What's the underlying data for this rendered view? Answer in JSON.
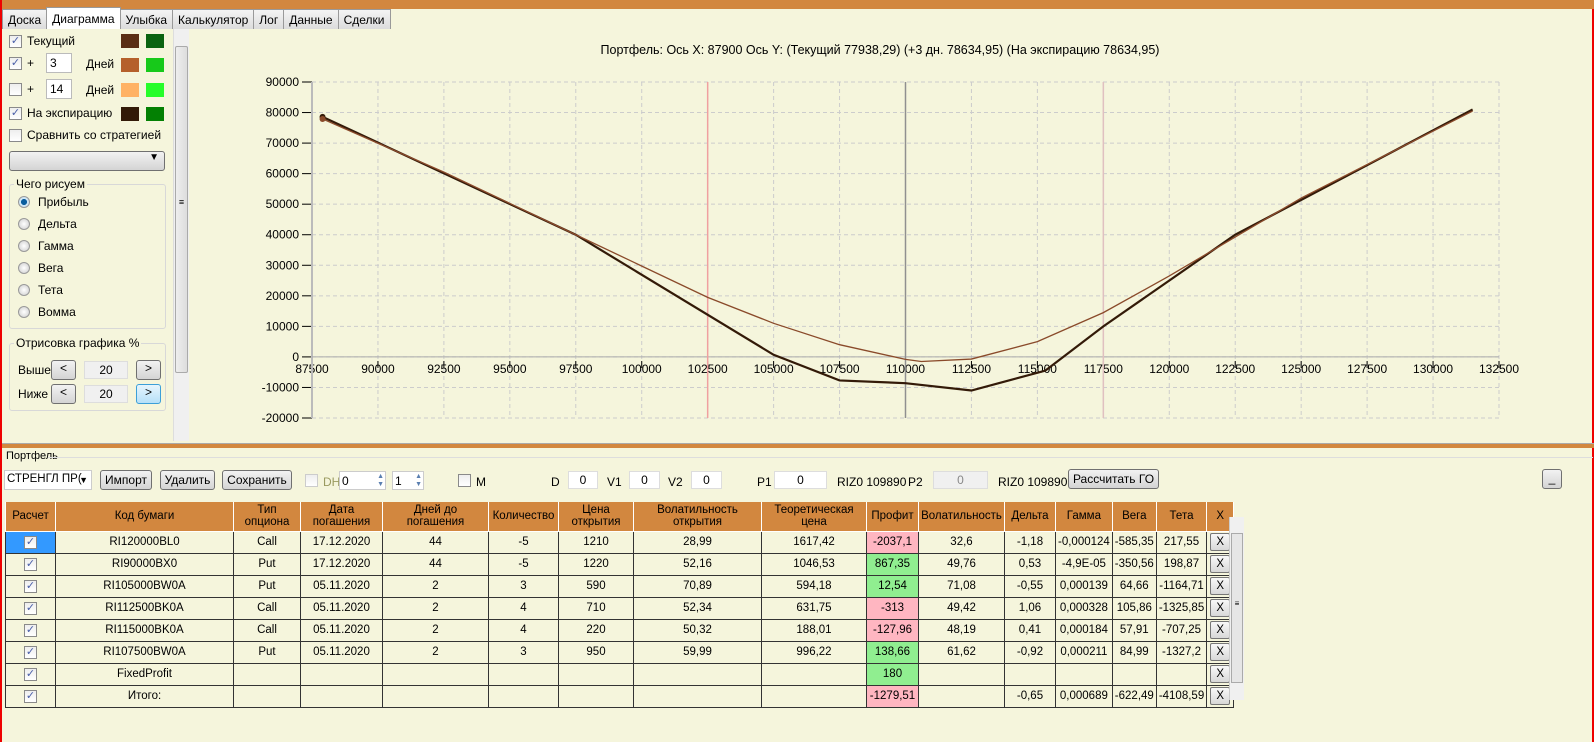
{
  "tabs": [
    "Доска",
    "Диаграмма",
    "Улыбка",
    "Калькулятор",
    "Лог",
    "Данные",
    "Сделки"
  ],
  "active_tab": "Диаграмма",
  "left": {
    "current_label": "Текущий",
    "plus": "+",
    "days_label": "Дней",
    "days1": "3",
    "days2": "14",
    "expiry_label": "На экспирацию",
    "compare_label": "Сравнить со стратегией",
    "colors": {
      "current": [
        "#5a2d14",
        "#0a6310"
      ],
      "d1": [
        "#b5602b",
        "#17c91a"
      ],
      "d2": [
        "#ffb265",
        "#27fd2a"
      ],
      "expiry": [
        "#331a08",
        "#038003"
      ]
    },
    "draw_group": "Чего рисуем",
    "radios": [
      "Прибыль",
      "Дельта",
      "Гамма",
      "Вега",
      "Тета",
      "Вомма"
    ],
    "pct_group": "Отрисовка графика %",
    "above": "Выше",
    "below": "Ниже",
    "above_val": "20",
    "below_val": "20",
    "lt": "<",
    "gt": ">"
  },
  "chart_title": "Портфель: Ось X: 87900 Ось Y:  (Текущий 77938,29)  (+3 дн. 78634,95)  (На экспирацию 78634,95)",
  "chart_data": {
    "type": "line",
    "xlim": [
      87500,
      132500
    ],
    "ylim": [
      -20000,
      90000
    ],
    "xticks": [
      87500,
      90000,
      92500,
      95000,
      97500,
      100000,
      102500,
      105000,
      107500,
      110000,
      112500,
      115000,
      117500,
      120000,
      122500,
      125000,
      127500,
      130000,
      132500
    ],
    "yticks": [
      -20000,
      -10000,
      0,
      10000,
      20000,
      30000,
      40000,
      50000,
      60000,
      70000,
      80000,
      90000
    ],
    "vlines": [
      {
        "x": 102500,
        "color": "#f0a0a0"
      },
      {
        "x": 110000,
        "color": "#909090"
      },
      {
        "x": 117500,
        "color": "#e0c0c0"
      }
    ],
    "series": [
      {
        "name": "На экспирацию",
        "color": "#331a08",
        "x": [
          87900,
          97500,
          105000,
          107500,
          110000,
          112500,
          115300,
          117500,
          122500,
          131500
        ],
        "y": [
          78600,
          40000,
          700,
          -7700,
          -8600,
          -11000,
          -4500,
          10000,
          40000,
          81000
        ]
      },
      {
        "name": "Текущий",
        "color": "#8a4a2a",
        "x": [
          87900,
          92500,
          97500,
          102500,
          105000,
          107500,
          110000,
          110600,
          112500,
          115000,
          117500,
          120000,
          125000,
          131500
        ],
        "y": [
          77900,
          60500,
          40000,
          19500,
          11000,
          4000,
          -800,
          -1500,
          -700,
          5000,
          14500,
          26500,
          52000,
          80500
        ]
      }
    ]
  },
  "portfolio": {
    "title": "Портфель",
    "strategy": "СТРЕНГЛ ПР(",
    "import": "Импорт",
    "delete": "Удалить",
    "save": "Сохранить",
    "dh": "DH",
    "spin1": "0",
    "spin2": "1",
    "m": "M",
    "d": "D",
    "d_val": "0",
    "v1": "V1",
    "v1_val": "0",
    "v2": "V2",
    "v2_val": "0",
    "p1": "P1",
    "p1_val": "0",
    "riz1": "RIZ0 109890",
    "p2": "P2",
    "p2_val": "0",
    "riz2": "RIZ0 109890",
    "calc": "Рассчитать ГО",
    "min": "_"
  },
  "table": {
    "headers": [
      "Расчет",
      "Код бумаги",
      "Тип опциона",
      "Дата погашения",
      "Дней до погашения",
      "Количество",
      "Цена открытия",
      "Волатильность открытия",
      "Теоретическая цена",
      "Профит",
      "Волатильность",
      "Дельта",
      "Гамма",
      "Вега",
      "Тета",
      "X"
    ],
    "rows": [
      [
        "RI120000BL0",
        "Call",
        "17.12.2020",
        "44",
        "-5",
        "1210",
        "28,99",
        "1617,42",
        "-2037,1",
        "32,6",
        "-1,18",
        "-0,000124",
        "-585,35",
        "217,55"
      ],
      [
        "RI90000BX0",
        "Put",
        "17.12.2020",
        "44",
        "-5",
        "1220",
        "52,16",
        "1046,53",
        "867,35",
        "49,76",
        "0,53",
        "-4,9E-05",
        "-350,56",
        "198,87"
      ],
      [
        "RI105000BW0A",
        "Put",
        "05.11.2020",
        "2",
        "3",
        "590",
        "70,89",
        "594,18",
        "12,54",
        "71,08",
        "-0,55",
        "0,000139",
        "64,66",
        "-1164,71"
      ],
      [
        "RI112500BK0A",
        "Call",
        "05.11.2020",
        "2",
        "4",
        "710",
        "52,34",
        "631,75",
        "-313",
        "49,42",
        "1,06",
        "0,000328",
        "105,86",
        "-1325,85"
      ],
      [
        "RI115000BK0A",
        "Call",
        "05.11.2020",
        "2",
        "4",
        "220",
        "50,32",
        "188,01",
        "-127,96",
        "48,19",
        "0,41",
        "0,000184",
        "57,91",
        "-707,25"
      ],
      [
        "RI107500BW0A",
        "Put",
        "05.11.2020",
        "2",
        "3",
        "950",
        "59,99",
        "996,22",
        "138,66",
        "61,62",
        "-0,92",
        "0,000211",
        "84,99",
        "-1327,2"
      ],
      [
        "FixedProfit",
        "",
        "",
        "",
        "",
        "",
        "",
        "",
        "180",
        "",
        "",
        "",
        "",
        ""
      ],
      [
        "Итого:",
        "",
        "",
        "",
        "",
        "",
        "",
        "",
        "-1279,51",
        "",
        "-0,65",
        "0,000689",
        "-622,49",
        "-4108,59"
      ]
    ],
    "x_label": "X",
    "check": "✓"
  }
}
